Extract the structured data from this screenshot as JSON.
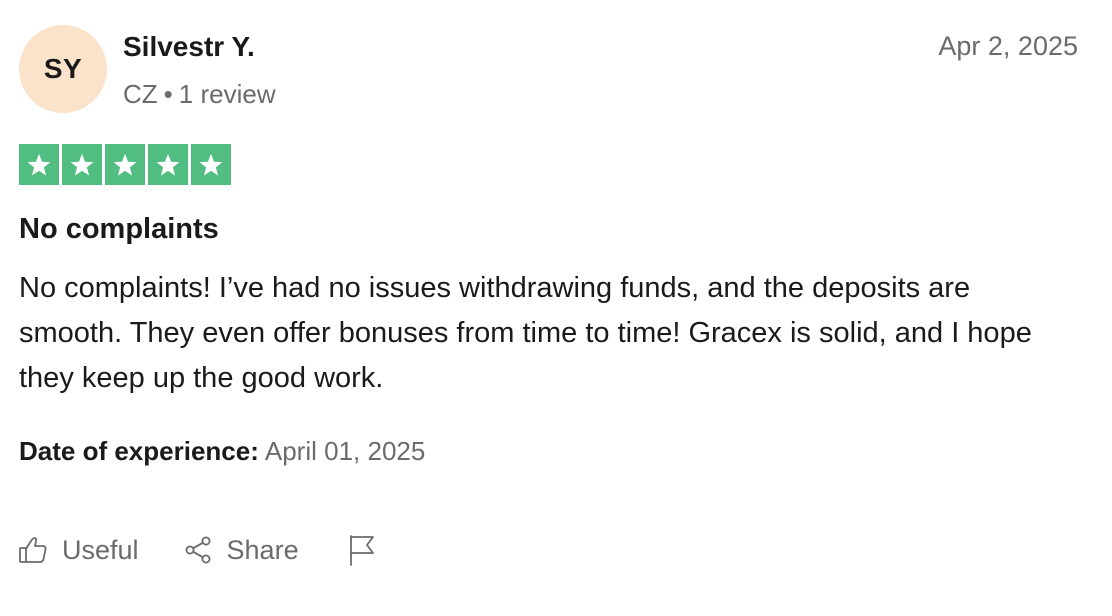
{
  "reviewer": {
    "initials": "SY",
    "name": "Silvestr Y.",
    "country": "CZ",
    "separator": "•",
    "review_count": "1 review",
    "avatar_color": "#fbe3cb"
  },
  "review": {
    "date": "Apr 2, 2025",
    "rating": 5,
    "rating_max": 5,
    "star_color": "#52bd80",
    "title": "No complaints",
    "body": "No complaints! I’ve had no issues withdrawing funds, and the deposits are smooth. They even offer bonuses from time to time! Gracex is solid, and I hope they keep up the good work.",
    "experience_label": "Date of experience:",
    "experience_date": "April 01, 2025"
  },
  "actions": {
    "useful_label": "Useful",
    "useful_icon": "thumbs-up-icon",
    "share_label": "Share",
    "share_icon": "share-icon",
    "report_icon": "flag-icon"
  }
}
